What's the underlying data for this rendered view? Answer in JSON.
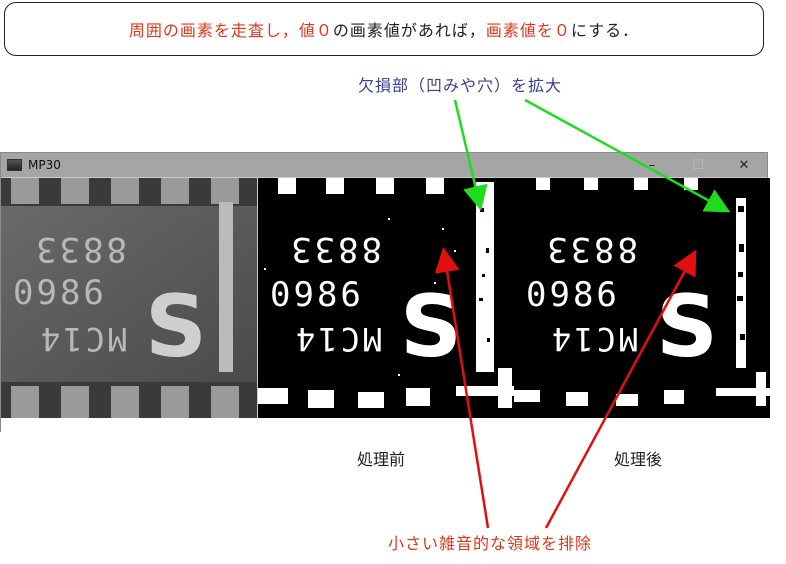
{
  "callout": {
    "part1": "周囲の画素を走査し，",
    "part2": "値０",
    "part3": "の画素値があれば，",
    "part4": "画素値を０",
    "part5": "にする．"
  },
  "annotations": {
    "defect_label": "欠損部（凹みや穴）を拡大",
    "noise_label": "小さい雑音的な領域を排除"
  },
  "window": {
    "title": "MP30",
    "minimize": "–",
    "maximize": "☐",
    "close": "✕"
  },
  "chip": {
    "row1": "8833",
    "row2": "0986",
    "row3": "MC14",
    "logo": "S"
  },
  "captions": {
    "before": "処理前",
    "after": "処理後"
  },
  "colors": {
    "red": "#d9381e",
    "green": "#1fdc1f",
    "blue_label": "#3a3f8f"
  }
}
